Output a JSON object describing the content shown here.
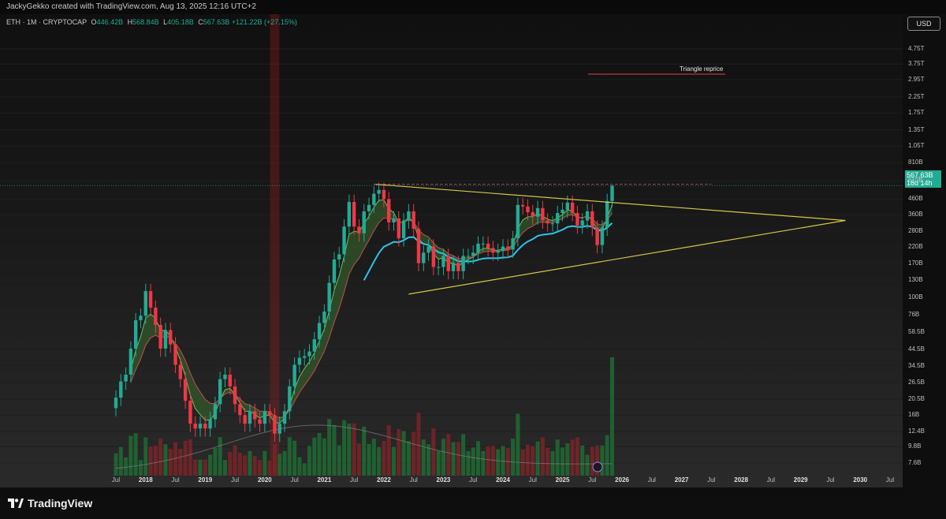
{
  "header": {
    "credit": "JackyGekko created with TradingView.com, Aug 13, 2025 12:16 UTC+2"
  },
  "legend": {
    "symbol": "ETH · 1M · CRYPTOCAP",
    "open_label": "O",
    "open": "446.42B",
    "high_label": "H",
    "high": "568.84B",
    "low_label": "L",
    "low": "405.18B",
    "close_label": "C",
    "close": "567.63B",
    "change": "+121.22B (+27.15%)"
  },
  "currency_button": "USD",
  "price_badge": {
    "price": "567.63B",
    "countdown": "18d 14h"
  },
  "annotation": "Triangle reprice",
  "footer": {
    "brand": "TradingView"
  },
  "colors": {
    "up": "#22ab94",
    "down": "#f23645",
    "trend_line": "#d4c64a",
    "ma_blue": "#2ec4ea",
    "ema_fill_green": "#3a6b30",
    "ema_fill_red": "#6b2a2a",
    "volume_up": "#1f6b33",
    "volume_down": "#7a2328"
  },
  "chart_data": {
    "type": "candlestick",
    "title": "ETH · 1M · CRYPTOCAP",
    "y_scale": "log",
    "y_unit": "USD market cap (B = billion, T = trillion)",
    "y_tick_labels": [
      "4.75T",
      "3.75T",
      "2.95T",
      "2.25T",
      "1.75T",
      "1.35T",
      "1.05T",
      "810B",
      "610B",
      "460B",
      "360B",
      "280B",
      "220B",
      "170B",
      "130B",
      "100B",
      "76B",
      "58.5B",
      "44.5B",
      "34.5B",
      "26.5B",
      "20.5B",
      "16B",
      "12.4B",
      "9.8B",
      "7.6B"
    ],
    "y_tick_values": [
      4750,
      3750,
      2950,
      2250,
      1750,
      1350,
      1050,
      810,
      610,
      460,
      360,
      280,
      220,
      170,
      130,
      100,
      76,
      58.5,
      44.5,
      34.5,
      26.5,
      20.5,
      16,
      12.4,
      9.8,
      7.6
    ],
    "x_tick_labels": [
      "Jul",
      "2018",
      "Jul",
      "2019",
      "Jul",
      "2020",
      "Jul",
      "2021",
      "Jul",
      "2022",
      "Jul",
      "2023",
      "Jul",
      "2024",
      "Jul",
      "2025",
      "Jul",
      "2026",
      "Jul",
      "2027",
      "Jul",
      "2028",
      "Jul",
      "2029",
      "Jul",
      "2030",
      "Jul"
    ],
    "x_tick_dates": [
      "2017-07",
      "2018-01",
      "2018-07",
      "2019-01",
      "2019-07",
      "2020-01",
      "2020-07",
      "2021-01",
      "2021-07",
      "2022-01",
      "2022-07",
      "2023-01",
      "2023-07",
      "2024-01",
      "2024-07",
      "2025-01",
      "2025-07",
      "2026-01",
      "2026-07",
      "2027-01",
      "2027-07",
      "2028-01",
      "2028-07",
      "2029-01",
      "2029-07",
      "2030-01",
      "2030-07"
    ],
    "x_range": [
      "2017-05",
      "2030-10"
    ],
    "start_month": "2017-07",
    "close_values_B": [
      21,
      27,
      30,
      45,
      70,
      75,
      110,
      85,
      65,
      45,
      60,
      48,
      35,
      28,
      20,
      14,
      13,
      14,
      13,
      15,
      19,
      28,
      30,
      25,
      19,
      16,
      14,
      17,
      15,
      14,
      17,
      16,
      12,
      14,
      17,
      25,
      35,
      39,
      40,
      43,
      52,
      67,
      80,
      125,
      180,
      195,
      300,
      440,
      300,
      270,
      380,
      420,
      500,
      530,
      460,
      320,
      340,
      250,
      330,
      380,
      290,
      170,
      200,
      220,
      160,
      160,
      190,
      150,
      170,
      150,
      190,
      190,
      200,
      230,
      230,
      215,
      200,
      205,
      220,
      210,
      250,
      420,
      410,
      375,
      350,
      400,
      330,
      315,
      315,
      370,
      390,
      435,
      370,
      305,
      330,
      380,
      295,
      225,
      295,
      446,
      568
    ],
    "last_candle": {
      "open": 446.42,
      "high": 568.84,
      "low": 405.18,
      "close": 567.63,
      "change": 121.22,
      "change_pct": 27.15
    },
    "triangle": {
      "upper_line": [
        [
          "2021-11",
          580
        ],
        [
          "2029-10",
          330
        ]
      ],
      "lower_line": [
        [
          "2022-06",
          105
        ],
        [
          "2029-10",
          330
        ]
      ],
      "all_time_high_ref": 580
    },
    "annotations": [
      "Triangle reprice"
    ],
    "grid": true,
    "legend_position": "top-left"
  }
}
